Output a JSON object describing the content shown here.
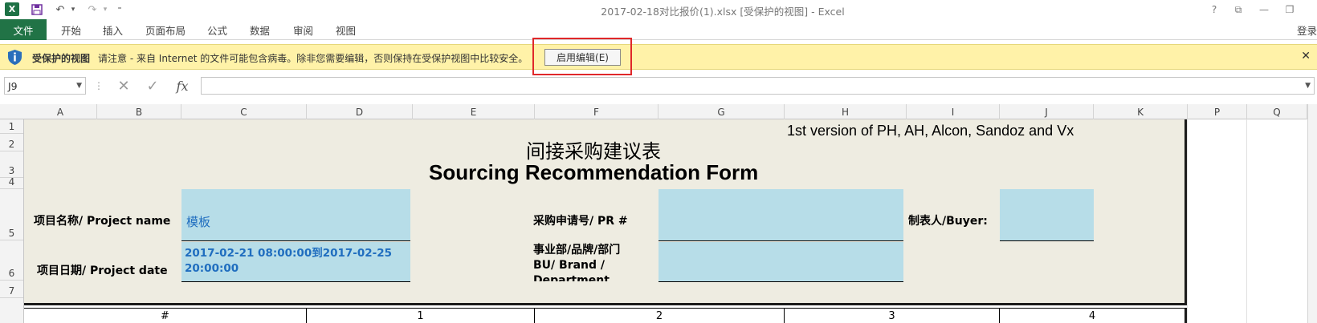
{
  "titlebar": {
    "excel_logo": "X",
    "save_icon": "save-icon",
    "undo_icon": "undo-icon",
    "redo_icon": "redo-icon",
    "title": "2017-02-18对比报价(1).xlsx  [受保护的视图] - Excel",
    "help": "?",
    "restore_ribbon": "⧉",
    "minimize": "—",
    "maximize": "❐"
  },
  "ribbon": {
    "file_tab": "文件",
    "tabs": [
      "开始",
      "插入",
      "页面布局",
      "公式",
      "数据",
      "审阅",
      "视图"
    ],
    "signin": "登录"
  },
  "protected_view": {
    "title": "受保护的视图",
    "message": "请注意 - 来自 Internet 的文件可能包含病毒。除非您需要编辑，否则保持在受保护视图中比较安全。",
    "enable_button": "启用编辑(E)",
    "close": "✕",
    "highlight_color": "#e0282a"
  },
  "formula_bar": {
    "name_box": "J9",
    "cancel": "✕",
    "enter": "✓",
    "fx": "fx",
    "value": ""
  },
  "grid": {
    "columns": [
      "A",
      "B",
      "C",
      "D",
      "E",
      "F",
      "G",
      "H",
      "I",
      "J",
      "K",
      "P",
      "Q"
    ],
    "rows": [
      "1",
      "2",
      "3",
      "4",
      "5",
      "6",
      "7"
    ]
  },
  "form": {
    "version_note": "1st version of PH, AH, Alcon, Sandoz and Vx",
    "title_cn": "间接采购建议表",
    "title_en": "Sourcing Recommendation Form",
    "project_name_label": "项目名称/ Project name",
    "project_name_value": "模板",
    "pr_label": "采购申请号/ PR #",
    "buyer_label": "制表人/Buyer:",
    "project_date_label": "项目日期/ Project date",
    "project_date_value_line1": "2017-02-21 08:00:00到2017-02-25",
    "project_date_value_line2": "20:00:00",
    "bu_label_line1": "事业部/品牌/部门",
    "bu_label_line2": "BU/ Brand /",
    "bu_label_line3": "Department",
    "table_headers": [
      "#",
      "1",
      "2",
      "3",
      "4"
    ],
    "background_color": "#eeece1",
    "input_color": "#b7dde8"
  }
}
